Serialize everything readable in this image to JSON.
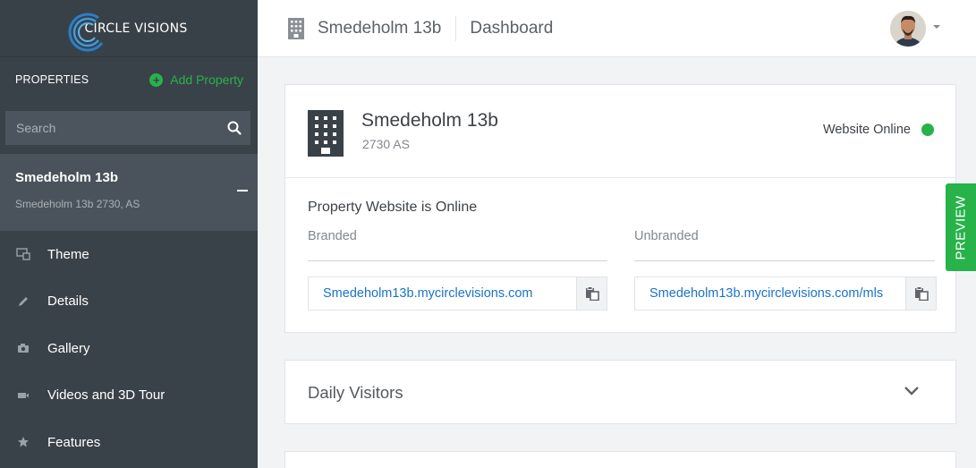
{
  "brand": {
    "name": "CIRCLE VISIONS",
    "accent": "#27b24a",
    "link_color": "#1a73c8"
  },
  "sidebar": {
    "properties_label": "PROPERTIES",
    "add_property_label": "Add Property",
    "search_placeholder": "Search",
    "active_property": {
      "name": "Smedeholm 13b",
      "address": "Smedeholm 13b 2730, AS"
    },
    "nav": [
      {
        "label": "Theme",
        "icon": "theme-icon"
      },
      {
        "label": "Details",
        "icon": "pencil-icon"
      },
      {
        "label": "Gallery",
        "icon": "camera-icon"
      },
      {
        "label": "Videos and 3D Tour",
        "icon": "video-icon"
      },
      {
        "label": "Features",
        "icon": "star-icon"
      }
    ]
  },
  "header": {
    "property": "Smedeholm 13b",
    "page": "Dashboard"
  },
  "property_card": {
    "title": "Smedeholm 13b",
    "subtitle": "2730 AS",
    "status": "Website Online",
    "heading": "Property Website is Online",
    "branded_label": "Branded",
    "branded_url": "Smedeholm13b.mycirclevisions.com",
    "unbranded_label": "Unbranded",
    "unbranded_url": "Smedeholm13b.mycirclevisions.com/mls"
  },
  "visitors_card": {
    "title": "Daily Visitors"
  },
  "preview_tab": {
    "label": "PREVIEW"
  }
}
